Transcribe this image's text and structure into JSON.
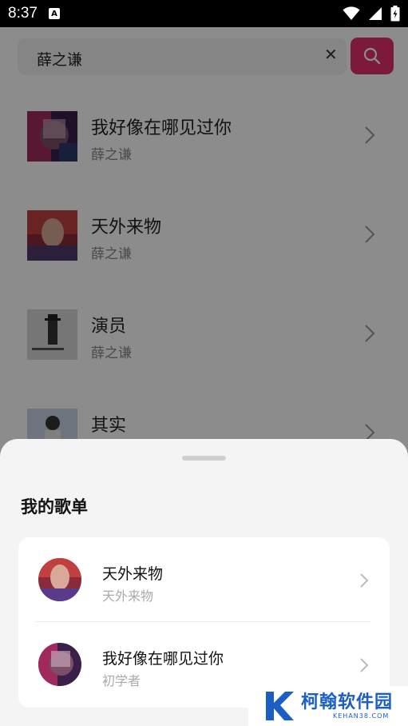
{
  "status_bar": {
    "time": "8:37",
    "notification_letter": "A"
  },
  "search": {
    "query": "薛之谦"
  },
  "songs": [
    {
      "title": "我好像在哪见过你",
      "artist": "薛之谦"
    },
    {
      "title": "天外来物",
      "artist": "薛之谦"
    },
    {
      "title": "演员",
      "artist": "薛之谦"
    },
    {
      "title": "其实",
      "artist": ""
    }
  ],
  "sheet": {
    "title": "我的歌单",
    "playlists": [
      {
        "name": "天外来物",
        "subtitle": "天外来物"
      },
      {
        "name": "我好像在哪见过你",
        "subtitle": "初学者"
      }
    ]
  },
  "watermark": {
    "cn": "柯翰软件园",
    "en": "KEHAN38.COM"
  },
  "colors": {
    "accent": "#e0306a",
    "watermark": "#1b5fc4"
  },
  "icons": [
    "wifi-icon",
    "signal-icon",
    "battery-icon",
    "close-icon",
    "search-icon",
    "chevron-right-icon"
  ]
}
